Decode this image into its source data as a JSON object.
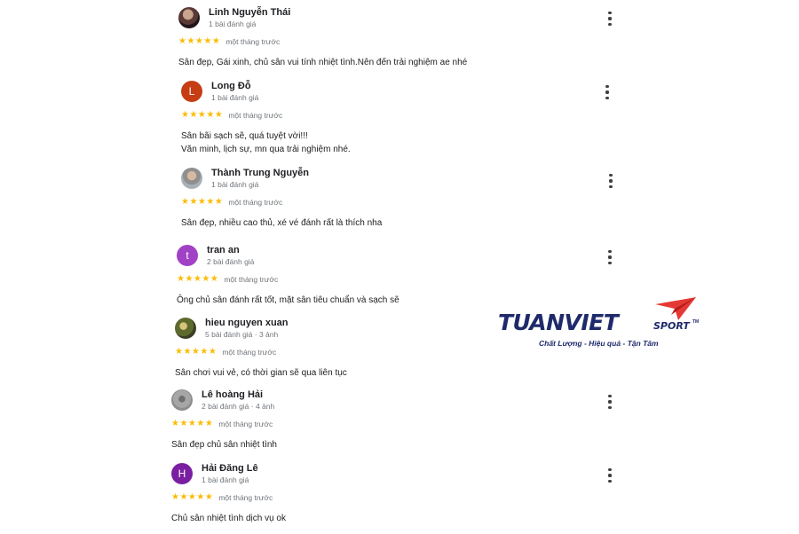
{
  "reviews": [
    {
      "name": "Linh Nguyễn Thái",
      "meta": "1 bài đánh giá",
      "stars": "★★★★★",
      "time": "một tháng trước",
      "text": "Sân đẹp, Gái xinh, chủ sân vui tính nhiệt tình.Nên đến trải nghiệm ae nhé",
      "avatar": {
        "type": "photo"
      }
    },
    {
      "name": "Long Đỗ",
      "meta": "1 bài đánh giá",
      "stars": "★★★★★",
      "time": "một tháng trước",
      "text": "Sân bãi sạch sẽ, quá tuyệt vời!!!\nVăn minh, lịch sự, mn qua trải nghiệm nhé.",
      "avatar": {
        "type": "letter",
        "letter": "L",
        "color": "#c63d14"
      }
    },
    {
      "name": "Thành Trung Nguyễn",
      "meta": "1 bài đánh giá",
      "stars": "★★★★★",
      "time": "một tháng trước",
      "text": "Sân đẹp, nhiều cao thủ, xé vé đánh rất là thích nha",
      "avatar": {
        "type": "photo"
      }
    },
    {
      "name": "tran an",
      "meta": "2 bài đánh giá",
      "stars": "★★★★★",
      "time": "một tháng trước",
      "text": "Ông chủ sân đánh rất tốt, mặt sân tiêu chuẩn và sạch sẽ",
      "avatar": {
        "type": "letter",
        "letter": "t",
        "color": "#a142c6"
      }
    },
    {
      "name": "hieu nguyen xuan",
      "meta": "5 bài đánh giá · 3 ảnh",
      "stars": "★★★★★",
      "time": "một tháng trước",
      "text": "Sân chơi vui vẻ, có thời gian sẽ qua liên tục",
      "avatar": {
        "type": "photo"
      }
    },
    {
      "name": "Lê hoàng Hải",
      "meta": "2 bài đánh giá · 4 ảnh",
      "stars": "★★★★★",
      "time": "một tháng trước",
      "text": "Sân đẹp chủ sân nhiệt tình",
      "avatar": {
        "type": "photo"
      }
    },
    {
      "name": "Hải Đăng Lê",
      "meta": "1 bài đánh giá",
      "stars": "★★★★★",
      "time": "một tháng trước",
      "text": "Chủ sân nhiệt tình dịch vụ ok",
      "avatar": {
        "type": "letter",
        "letter": "H",
        "color": "#7b1fa2"
      }
    }
  ],
  "logo": {
    "brand": "TUANVIET",
    "sport": "SPORT",
    "tm": "TM",
    "slogan": "Chất Lượng - Hiệu quả - Tận Tâm",
    "brand_color": "#1f2a6b",
    "accent_color": "#e53935"
  },
  "colors": {
    "star": "#fbbc04",
    "meta": "#70757a"
  },
  "icons": {
    "more": "more-vert-icon",
    "star": "star-icon"
  }
}
